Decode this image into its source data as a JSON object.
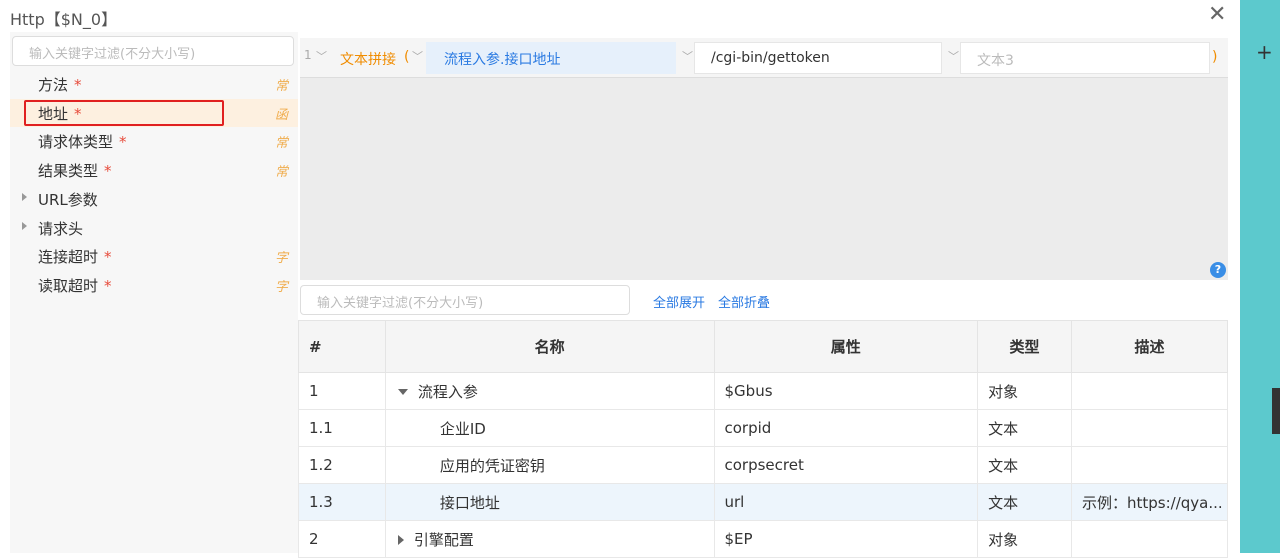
{
  "window": {
    "title": "Http【$N_0】",
    "close_icon": "close-icon"
  },
  "left_panel": {
    "search_placeholder": "输入关键字过滤(不分大小写)",
    "items": [
      {
        "label": "方法",
        "required": "*",
        "tag": "常",
        "expandable": false
      },
      {
        "label": "地址",
        "required": "*",
        "tag": "函",
        "expandable": false,
        "selected": true
      },
      {
        "label": "请求体类型",
        "required": "*",
        "tag": "常",
        "expandable": false
      },
      {
        "label": "结果类型",
        "required": "*",
        "tag": "常",
        "expandable": false
      },
      {
        "label": "URL参数",
        "required": "",
        "tag": "",
        "expandable": true
      },
      {
        "label": "请求头",
        "required": "",
        "tag": "",
        "expandable": true
      },
      {
        "label": "连接超时",
        "required": "*",
        "tag": "字",
        "expandable": false
      },
      {
        "label": "读取超时",
        "required": "*",
        "tag": "字",
        "expandable": false
      }
    ]
  },
  "expression": {
    "index": "1",
    "function_name": "文本拼接",
    "open_paren": "(",
    "close_paren": ")",
    "arg1": "流程入参.接口地址",
    "arg2": "/cgi-bin/gettoken",
    "arg3_placeholder": "文本3",
    "help": "?"
  },
  "variables": {
    "search_placeholder": "输入关键字过滤(不分大小写)",
    "expand_all": "全部展开",
    "collapse_all": "全部折叠",
    "columns": [
      "#",
      "名称",
      "属性",
      "类型",
      "描述"
    ],
    "rows": [
      {
        "idx": "1",
        "name": "流程入参",
        "attr": "$Gbus",
        "type": "对象",
        "desc": "",
        "level": 0,
        "toggle": "down"
      },
      {
        "idx": "1.1",
        "name": "企业ID",
        "attr": "corpid",
        "type": "文本",
        "desc": "",
        "level": 1,
        "toggle": ""
      },
      {
        "idx": "1.2",
        "name": "应用的凭证密钥",
        "attr": "corpsecret",
        "type": "文本",
        "desc": "",
        "level": 1,
        "toggle": ""
      },
      {
        "idx": "1.3",
        "name": "接口地址",
        "attr": "url",
        "type": "文本",
        "desc": "示例：https://qya...",
        "level": 1,
        "toggle": "",
        "highlight": true
      },
      {
        "idx": "2",
        "name": "引擎配置",
        "attr": "$EP",
        "type": "对象",
        "desc": "",
        "level": 0,
        "toggle": "right"
      }
    ]
  },
  "side_strip": {
    "plus": "+"
  },
  "colors": {
    "accent": "#2a7ae2",
    "function": "#f08c00",
    "tag": "#f0ad4e",
    "required": "#e74c3c",
    "strip": "#5cc9cd",
    "selection_border": "#e02020"
  }
}
